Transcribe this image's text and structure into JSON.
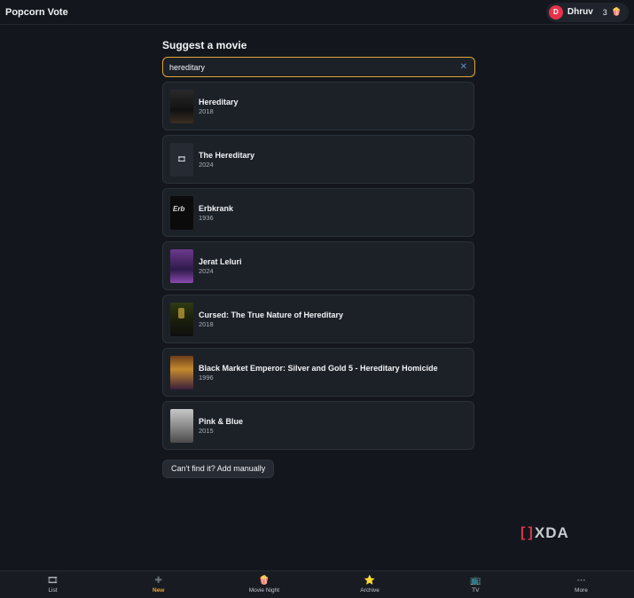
{
  "app": {
    "title": "Popcorn Vote"
  },
  "user": {
    "initial": "D",
    "name": "Dhruv",
    "popcorn_count": "3",
    "popcorn_icon": "popcorn-icon"
  },
  "page": {
    "heading": "Suggest a movie"
  },
  "search": {
    "value": "hereditary",
    "placeholder": "",
    "clear_icon": "✕"
  },
  "results": [
    {
      "title": "Hereditary",
      "year": "2018"
    },
    {
      "title": "The Hereditary",
      "year": "2024"
    },
    {
      "title": "Erbkrank",
      "year": "1936"
    },
    {
      "title": "Jerat Leluri",
      "year": "2024"
    },
    {
      "title": "Cursed: The True Nature of Hereditary",
      "year": "2018"
    },
    {
      "title": "Black Market Emperor: Silver and Gold 5 - Hereditary Homicide",
      "year": "1996"
    },
    {
      "title": "Pink & Blue",
      "year": "2015"
    }
  ],
  "add_manual_label": "Can't find it? Add manually",
  "watermark": {
    "text": "XDA"
  },
  "nav": [
    {
      "label": "List",
      "icon": "film-icon",
      "glyph": "🎞",
      "active": false
    },
    {
      "label": "New",
      "icon": "plus-icon",
      "glyph": "✚",
      "active": true
    },
    {
      "label": "Movie Night",
      "icon": "popcorn-icon",
      "glyph": "🍿",
      "active": false
    },
    {
      "label": "Archive",
      "icon": "star-icon",
      "glyph": "⭐",
      "active": false
    },
    {
      "label": "TV",
      "icon": "tv-icon",
      "glyph": "📺",
      "active": false
    },
    {
      "label": "More",
      "icon": "more-icon",
      "glyph": "⋯",
      "active": false
    }
  ],
  "colors": {
    "accent": "#f0a530",
    "background": "#13171d",
    "card": "#1c2128",
    "avatar": "#e5334a"
  }
}
